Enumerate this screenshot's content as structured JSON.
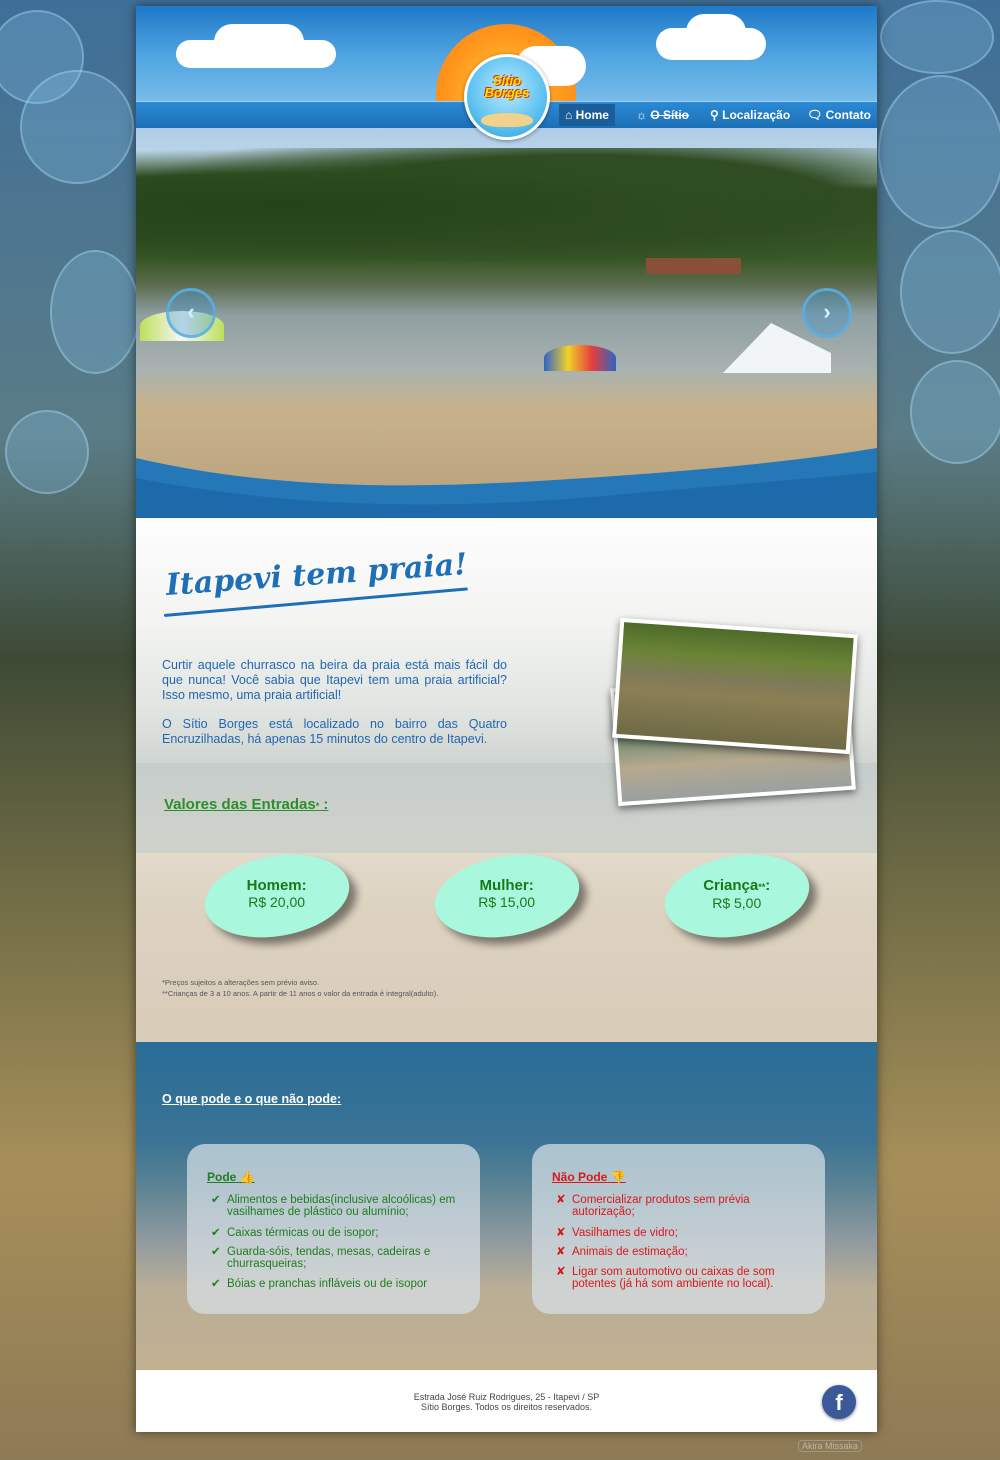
{
  "brand": {
    "logo_text_line1": "Sítio",
    "logo_text_line2": "Borges"
  },
  "nav": {
    "items": [
      {
        "icon": "home-icon",
        "label": "Home",
        "active": true
      },
      {
        "icon": "sun-icon",
        "label": "O Sítio",
        "active": false
      },
      {
        "icon": "map-marker-icon",
        "label": "Localização",
        "active": false
      },
      {
        "icon": "chat-bubble-icon",
        "label": "Contato",
        "active": false
      }
    ]
  },
  "slider": {
    "prev_icon": "chevron-left-icon",
    "next_icon": "chevron-right-icon"
  },
  "intro": {
    "title": "Itapevi tem praia!",
    "paragraph1": "Curtir aquele churrasco na beira da praia está mais fácil do que nunca! Você sabia que Itapevi tem uma praia artificial? Isso mesmo, uma praia artificial!",
    "paragraph2": "O Sítio Borges está localizado no bairro das Quatro Encruzilhadas, há apenas 15 minutos do centro de Itapevi."
  },
  "prices": {
    "heading": "Valores das Entradas",
    "heading_mark": "*",
    "heading_suffix": " :",
    "items": [
      {
        "label": "Homem:",
        "value": "R$ 20,00"
      },
      {
        "label": "Mulher:",
        "value": "R$ 15,00"
      },
      {
        "label": "Criança",
        "label_mark": "**",
        "label_suffix": ":",
        "value": "R$ 5,00"
      }
    ],
    "note1": "*Preços sujeitos a alterações sem prévio aviso.",
    "note2": "**Crianças de 3 a 10 anos. A partir de 11 anos o valor da entrada é integral(adulto)."
  },
  "rules": {
    "heading": "O que pode e o que não pode:",
    "allowed": {
      "title": "Pode",
      "icon": "thumbs-up-icon",
      "items": [
        "Alimentos e bebidas(inclusive alcoólicas) em vasilhames de plástico ou alumínio;",
        "Caixas térmicas ou de isopor;",
        "Guarda-sóis, tendas, mesas, cadeiras e churrasqueiras;",
        "Bóias e pranchas infláveis ou de isopor"
      ]
    },
    "forbidden": {
      "title": "Não Pode",
      "icon": "thumbs-down-icon",
      "items": [
        "Comercializar produtos sem prévia autorização;",
        "Vasilhames de vidro;",
        "Animais de estimação;",
        "Ligar som automotivo ou caixas de som potentes (já há som ambiente no local)."
      ]
    }
  },
  "footer": {
    "address": "Estrada José Ruiz Rodrigues, 25 - Itapevi / SP",
    "copyright": "Sítio Borges. Todos os direitos reservados.",
    "facebook_label": "f"
  },
  "watermark": "Akira Missaka",
  "colors": {
    "brand_blue": "#1e6fb8",
    "nav_blue": "#1b6fb6",
    "price_oval": "#a9f7dc",
    "allowed_green": "#1f7d1f",
    "forbidden_red": "#d8191b",
    "facebook": "#3b5998"
  }
}
